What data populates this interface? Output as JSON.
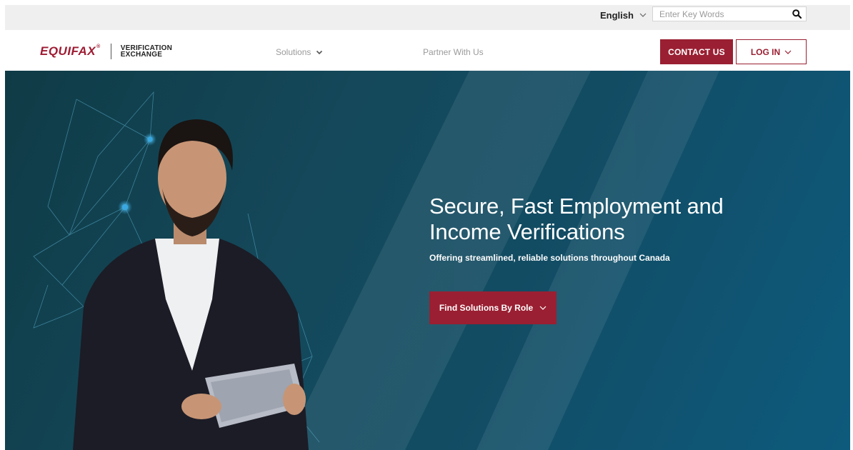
{
  "utility_bar": {
    "language": "English",
    "search": {
      "placeholder": "Enter Key Words",
      "value": ""
    }
  },
  "header": {
    "logo": {
      "brand": "EQUIFAX",
      "trademark": "®",
      "sub_line1": "VERIFICATION",
      "sub_line2": "EXCHANGE"
    },
    "nav": [
      {
        "label": "Solutions",
        "has_dropdown": true
      },
      {
        "label": "Partner With Us",
        "has_dropdown": false
      }
    ],
    "contact_label": "CONTACT US",
    "login_label": "LOG IN"
  },
  "hero": {
    "title": "Secure, Fast Employment and Income Verifications",
    "subtitle": "Offering streamlined, reliable solutions throughout Canada",
    "cta_label": "Find Solutions By Role"
  },
  "colors": {
    "brand_red": "#9a1f32",
    "hero_teal": "#124c63",
    "node_blue": "#3aa8e0"
  },
  "icons": {
    "search": "search-icon",
    "dropdown": "chevron-down-icon"
  }
}
